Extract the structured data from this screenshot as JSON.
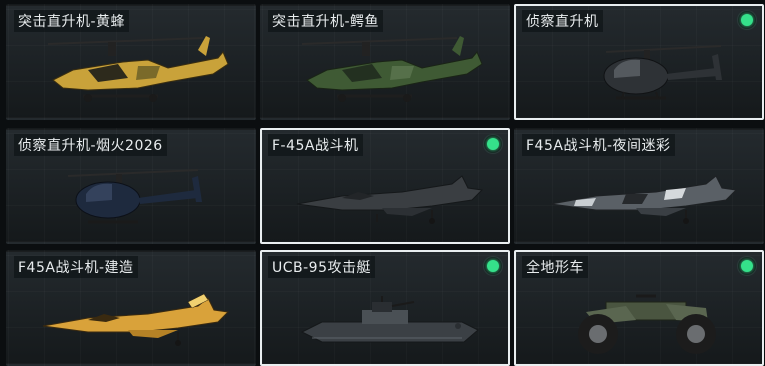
{
  "items": [
    {
      "label": "突击直升机-黄蜂",
      "equipped": false,
      "selected": false,
      "icon": "attack-helicopter-icon",
      "color": "#c9a23a"
    },
    {
      "label": "突击直升机-鳄鱼",
      "equipped": false,
      "selected": false,
      "icon": "attack-helicopter-icon",
      "color": "#3f5a34"
    },
    {
      "label": "侦察直升机",
      "equipped": true,
      "selected": true,
      "icon": "scout-helicopter-icon",
      "color": "#2e3236"
    },
    {
      "label": "侦察直升机-烟火2026",
      "equipped": false,
      "selected": false,
      "icon": "scout-helicopter-icon",
      "color": "#1e2a3e"
    },
    {
      "label": "F-45A战斗机",
      "equipped": true,
      "selected": true,
      "icon": "fighter-jet-icon",
      "color": "#3a3e42"
    },
    {
      "label": "F45A战斗机-夜间迷彩",
      "equipped": false,
      "selected": false,
      "icon": "fighter-jet-icon",
      "color": "#5a6066"
    },
    {
      "label": "F45A战斗机-建造",
      "equipped": false,
      "selected": false,
      "icon": "fighter-jet-icon",
      "color": "#d9a23a"
    },
    {
      "label": "UCB-95攻击艇",
      "equipped": true,
      "selected": true,
      "icon": "attack-boat-icon",
      "color": "#3b4045"
    },
    {
      "label": "全地形车",
      "equipped": true,
      "selected": true,
      "icon": "atv-icon",
      "color": "#4a5540"
    }
  ]
}
